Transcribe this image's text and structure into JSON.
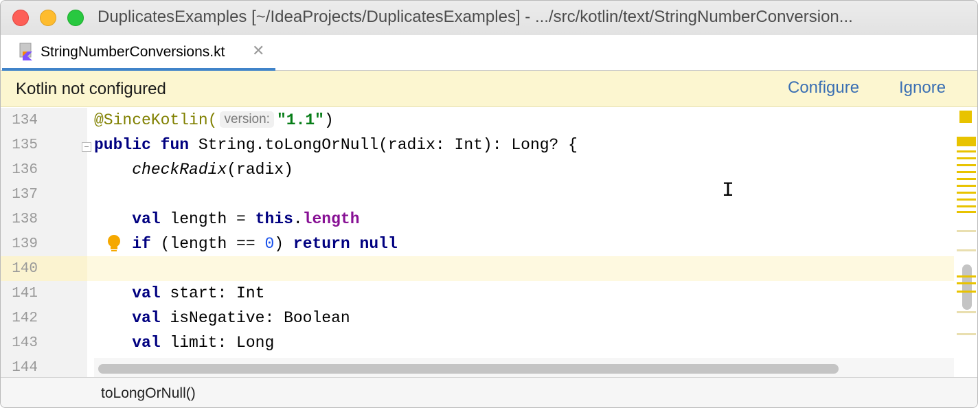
{
  "window": {
    "title": "DuplicatesExamples [~/IdeaProjects/DuplicatesExamples] - .../src/kotlin/text/StringNumberConversion..."
  },
  "tabs": [
    {
      "label": "StringNumberConversions.kt",
      "icon": "kotlin-file-icon",
      "active": true
    }
  ],
  "banner": {
    "message": "Kotlin not configured",
    "configure_label": "Configure",
    "ignore_label": "Ignore"
  },
  "editor": {
    "line_numbers": [
      "134",
      "135",
      "136",
      "137",
      "138",
      "139",
      "140",
      "141",
      "142",
      "143",
      "144"
    ],
    "current_line": "140",
    "inlay_hint": "version:",
    "code": {
      "l134_ann": "@SinceKotlin(",
      "l134_str": "\"1.1\"",
      "l134_end": ")",
      "l135_kw1": "public",
      "l135_kw2": "fun",
      "l135_rest": " String.toLongOrNull(radix: Int): Long? {",
      "l136_fn": "checkRadix",
      "l136_rest": "(radix)",
      "l138_kw": "val",
      "l138_mid": " length = ",
      "l138_this": "this",
      "l138_dot": ".",
      "l138_fld": "length",
      "l139_kw": "if",
      "l139_mid1": " (length == ",
      "l139_num": "0",
      "l139_mid2": ") ",
      "l139_ret": "return",
      "l139_sp": " ",
      "l139_null": "null",
      "l141_kw": "val",
      "l141_rest": " start: Int",
      "l142_kw": "val",
      "l142_rest": " isNegative: Boolean",
      "l143_kw": "val",
      "l143_rest": " limit: Long"
    }
  },
  "breadcrumb": {
    "item": "toLongOrNull()"
  },
  "colors": {
    "keyword": "#000080",
    "string": "#067d17",
    "number": "#1750eb",
    "field": "#871094",
    "banner_bg": "#fcf6d0",
    "link": "#3a6fb3",
    "tab_underline": "#4083c9",
    "warning_mark": "#e8c300"
  }
}
